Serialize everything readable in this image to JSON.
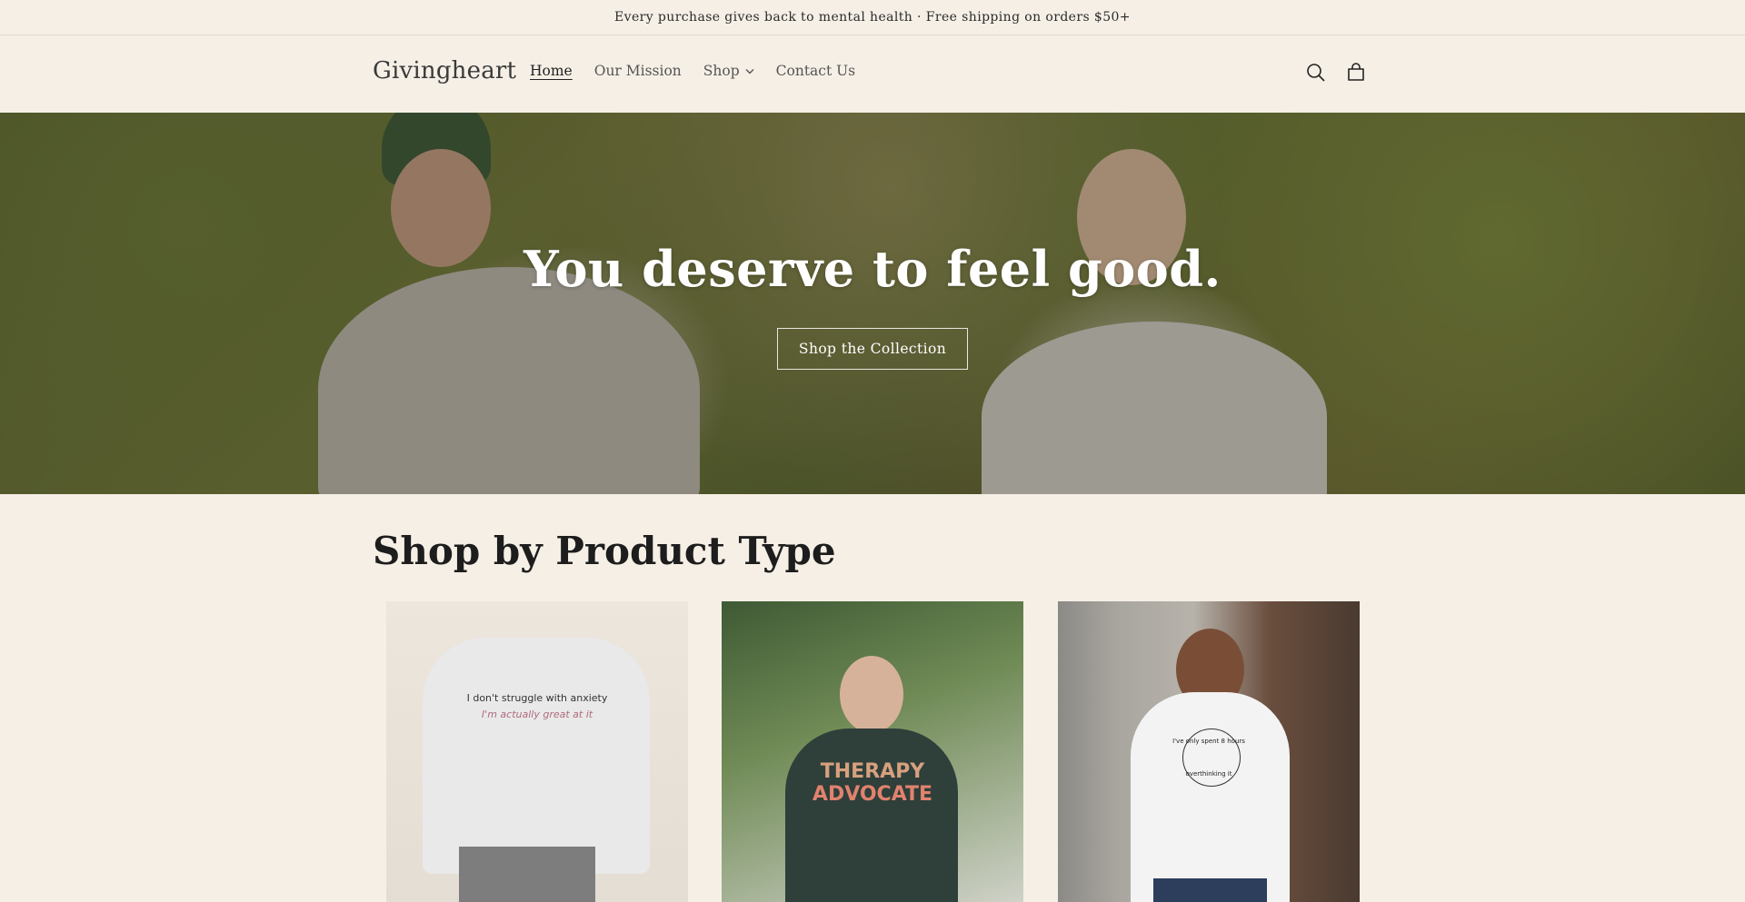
{
  "announcement": "Every purchase gives back to mental health · Free shipping on orders $50+",
  "header": {
    "logo": "Givingheart",
    "nav": [
      {
        "label": "Home",
        "active": true
      },
      {
        "label": "Our Mission"
      },
      {
        "label": "Shop",
        "has_dropdown": true
      },
      {
        "label": "Contact Us"
      }
    ],
    "icons": [
      "search-icon",
      "cart-icon"
    ]
  },
  "hero": {
    "title": "You deserve to feel good.",
    "button_label": "Shop the Collection"
  },
  "section": {
    "title": "Shop by Product Type"
  },
  "products": [
    {
      "print_line1": "I don't struggle with anxiety",
      "print_line2": "I'm actually great at it"
    },
    {
      "print_line1": "THERAPY",
      "print_line2": "ADVOCATE"
    },
    {
      "print_line1": "I've only spent 8 hours",
      "print_line2": "overthinking it"
    }
  ],
  "colors": {
    "background": "#f5efe6",
    "text": "#2b2b2b",
    "hero_text": "#ffffff"
  }
}
